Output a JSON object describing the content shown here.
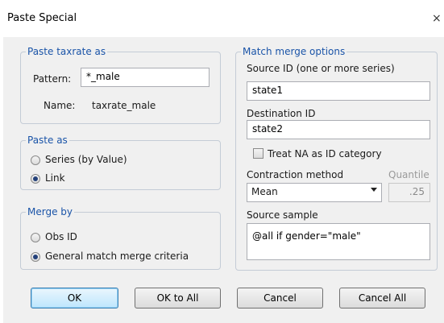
{
  "window": {
    "title": "Paste Special",
    "close_glyph": "×"
  },
  "paste_taxrate": {
    "legend": "Paste taxrate as",
    "pattern_label": "Pattern:",
    "pattern_value": "*_male",
    "name_label": "Name:",
    "name_value": "taxrate_male"
  },
  "paste_as": {
    "legend": "Paste as",
    "options": [
      {
        "label": "Series (by Value)",
        "selected": false
      },
      {
        "label": "Link",
        "selected": true
      }
    ]
  },
  "merge_by": {
    "legend": "Merge by",
    "options": [
      {
        "label": "Obs ID",
        "selected": false
      },
      {
        "label": "General match merge criteria",
        "selected": true
      }
    ]
  },
  "match_merge": {
    "legend": "Match merge options",
    "source_id_label": "Source ID (one or more series)",
    "source_id_value": "state1",
    "destination_id_label": "Destination ID",
    "destination_id_value": "state2",
    "treat_na_label": "Treat NA as ID category",
    "treat_na_checked": false,
    "contraction_label": "Contraction method",
    "contraction_value": "Mean",
    "quantile_label": "Quantile",
    "quantile_value": ".25",
    "source_sample_label": "Source sample",
    "source_sample_value": "@all if gender=\"male\""
  },
  "buttons": {
    "ok": "OK",
    "ok_to_all": "OK to All",
    "cancel": "Cancel",
    "cancel_all": "Cancel All"
  },
  "icons": {
    "close": "close-icon",
    "dropdown": "chevron-down-icon"
  },
  "colors": {
    "legend_text": "#1a54a8",
    "group_border": "#c4ccd6",
    "dialog_bg": "#f0f0f0"
  }
}
